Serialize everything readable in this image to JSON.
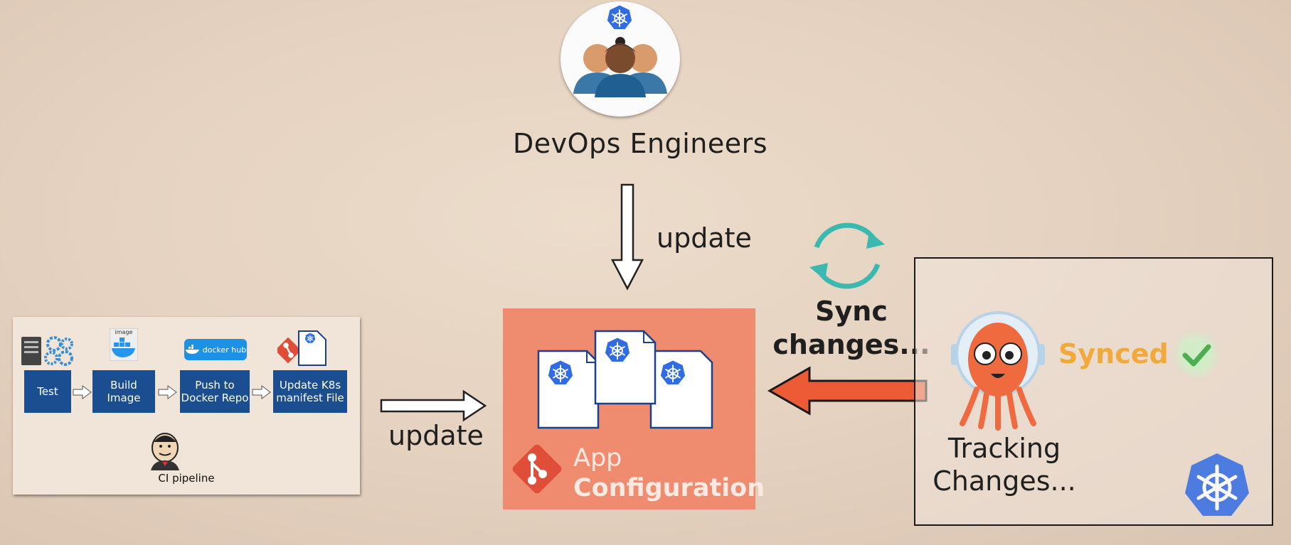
{
  "engineers": {
    "label": "DevOps Engineers"
  },
  "arrows": {
    "update_top": "update",
    "update_left": "update"
  },
  "ci_pipeline": {
    "image_tag": "image",
    "docker_hub_logo": "docker hub",
    "steps": [
      {
        "label": "Test"
      },
      {
        "label": "Build Image"
      },
      {
        "label": "Push to Docker Repo"
      },
      {
        "label": "Update K8s manifest File"
      }
    ],
    "label": "CI pipeline"
  },
  "app_config": {
    "title_line1": "App",
    "title_line2": "Configuration"
  },
  "sync": {
    "line1": "Sync",
    "line2": "changes..."
  },
  "argocd": {
    "status": "Synced",
    "tracking_line1": "Tracking",
    "tracking_line2": "Changes..."
  },
  "colors": {
    "step_blue": "#1b4e90",
    "k8s_blue": "#326ce5",
    "git_red": "#e04e39",
    "sync_teal": "#3bb8b0",
    "orange_arrow": "#ec5b36",
    "app_box": "#ef8c6f",
    "synced_text": "#f2a93b",
    "check_green": "#4caf50"
  }
}
